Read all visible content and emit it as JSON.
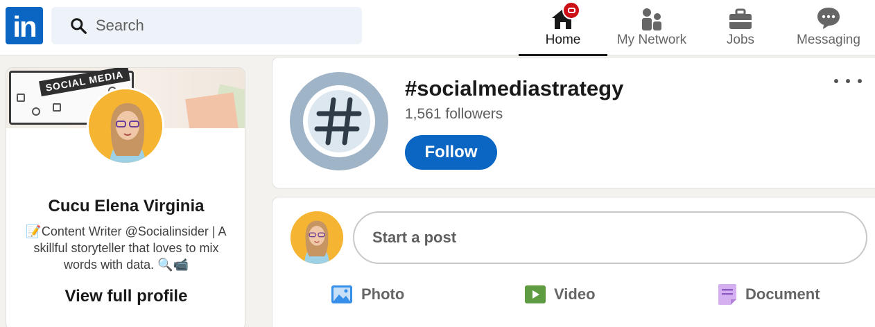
{
  "header": {
    "logo_text": "in",
    "search": {
      "placeholder": "Search"
    },
    "nav": [
      {
        "label": "Home",
        "icon": "home-icon",
        "active": true
      },
      {
        "label": "My Network",
        "icon": "network-icon"
      },
      {
        "label": "Jobs",
        "icon": "briefcase-icon"
      },
      {
        "label": "Messaging",
        "icon": "message-icon"
      }
    ]
  },
  "profile": {
    "banner_text": "SOCIAL MEDIA",
    "name": "Cucu Elena Virginia",
    "headline": "📝Content Writer @Socialinsider | A skillful storyteller that loves to mix words with data. 🔍📹",
    "view_profile": "View full profile"
  },
  "hashtag": {
    "title": "#socialmediastrategy",
    "followers": "1,561 followers",
    "follow_label": "Follow",
    "icon": "hashtag-icon"
  },
  "composer": {
    "placeholder": "Start a post",
    "actions": [
      {
        "label": "Photo",
        "icon": "photo-icon",
        "color": "#378fe9"
      },
      {
        "label": "Video",
        "icon": "video-icon",
        "color": "#5f9b41"
      },
      {
        "label": "Document",
        "icon": "document-icon",
        "color": "#c37d16"
      }
    ]
  },
  "colors": {
    "brand": "#0a66c2",
    "notification": "#cc1016"
  }
}
